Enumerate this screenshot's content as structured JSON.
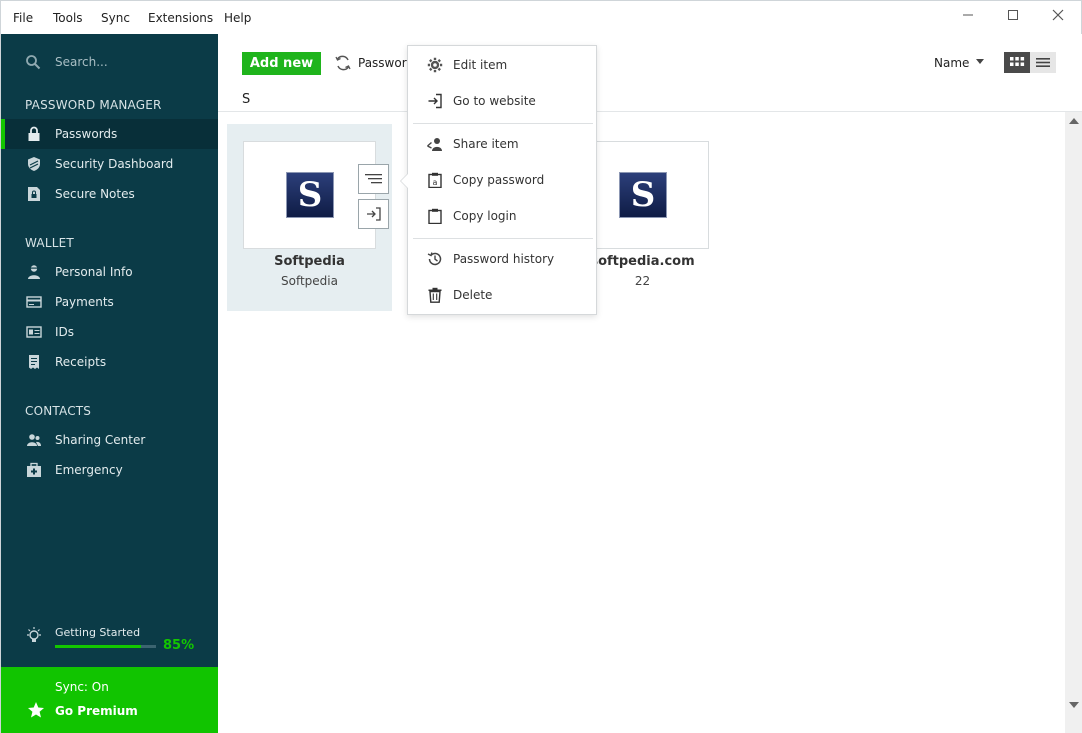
{
  "menubar": {
    "items": [
      "File",
      "Tools",
      "Sync",
      "Extensions",
      "Help"
    ]
  },
  "sidebar": {
    "search_placeholder": "Search...",
    "sections": [
      {
        "heading": "PASSWORD MANAGER",
        "items": [
          {
            "label": "Passwords",
            "icon": "lock-icon",
            "active": true
          },
          {
            "label": "Security Dashboard",
            "icon": "shield-icon"
          },
          {
            "label": "Secure Notes",
            "icon": "note-lock-icon"
          }
        ]
      },
      {
        "heading": "WALLET",
        "items": [
          {
            "label": "Personal Info",
            "icon": "person-icon"
          },
          {
            "label": "Payments",
            "icon": "card-icon"
          },
          {
            "label": "IDs",
            "icon": "id-card-icon"
          },
          {
            "label": "Receipts",
            "icon": "receipt-icon"
          }
        ]
      },
      {
        "heading": "CONTACTS",
        "items": [
          {
            "label": "Sharing Center",
            "icon": "people-icon"
          },
          {
            "label": "Emergency",
            "icon": "first-aid-icon"
          }
        ]
      }
    ],
    "getting_started": {
      "label": "Getting Started",
      "percent_text": "85%",
      "progress": 0.85
    },
    "sync_status": "Sync: On",
    "premium_label": "Go Premium"
  },
  "toolbar": {
    "add_new": "Add new",
    "passwords_label": "Password",
    "sort_label": "Name",
    "filter_letter": "S"
  },
  "tiles": [
    {
      "logo": "S",
      "name": "Softpedia",
      "sub": "Softpedia"
    },
    {
      "logo": "S",
      "name": "softpedia.com",
      "sub": "22"
    }
  ],
  "context_menu": {
    "items": [
      {
        "label": "Edit item",
        "icon": "gear-icon"
      },
      {
        "label": "Go to website",
        "icon": "go-to-icon"
      },
      {
        "label": "Share item",
        "icon": "share-icon"
      },
      {
        "label": "Copy password",
        "icon": "clipboard-a-icon"
      },
      {
        "label": "Copy login",
        "icon": "clipboard-icon"
      },
      {
        "label": "Password history",
        "icon": "history-icon"
      },
      {
        "label": "Delete",
        "icon": "trash-icon"
      }
    ]
  },
  "colors": {
    "sidebar_bg": "#0b3b47",
    "accent_green": "#13c600",
    "premium_bg": "#11c400",
    "add_button": "#1fb41c"
  }
}
